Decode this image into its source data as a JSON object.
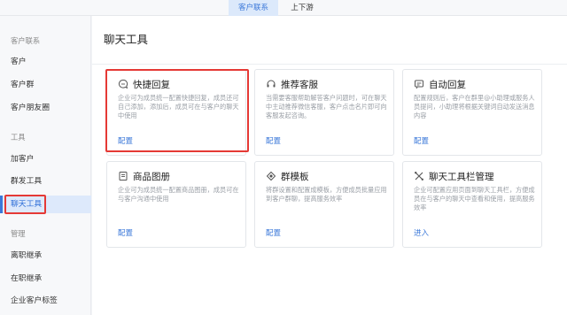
{
  "top_tabs": [
    {
      "label": "客户联系"
    },
    {
      "label": "上下游"
    }
  ],
  "sidebar": {
    "items": [
      {
        "label": "客户联系",
        "type": "heading"
      },
      {
        "label": "客户"
      },
      {
        "label": "客户群"
      },
      {
        "label": "客户朋友圈"
      },
      {
        "label": "工具",
        "type": "heading"
      },
      {
        "label": "加客户"
      },
      {
        "label": "群发工具"
      },
      {
        "label": "聊天工具",
        "active": true
      },
      {
        "label": "管理",
        "type": "heading"
      },
      {
        "label": "离职继承"
      },
      {
        "label": "在职继承"
      },
      {
        "label": "企业客户标签"
      }
    ]
  },
  "main": {
    "title": "聊天工具",
    "cards": [
      {
        "icon": "chat-bubble-icon",
        "title": "快捷回复",
        "desc": "企业可为成员统一配置快捷回复，成员还可自己添加，添加后，成员可在与客户的聊天中使用",
        "action": "配置"
      },
      {
        "icon": "headset-icon",
        "title": "推荐客服",
        "desc": "当需要客服帮助解答客户问题时，可在聊天中主动推荐微信客服，客户点击名片即可向客服发起咨询。",
        "action": "配置"
      },
      {
        "icon": "auto-reply-icon",
        "title": "自动回复",
        "desc": "配置规则后，客户在群里@小助理或服务人员提问，小助理将根据关键词自动发送消息内容",
        "action": "配置"
      },
      {
        "icon": "product-album-icon",
        "title": "商品图册",
        "desc": "企业可为成员统一配置商品图册，成员可在与客户沟通中使用",
        "action": "配置"
      },
      {
        "icon": "group-template-icon",
        "title": "群模板",
        "desc": "将群设置和配置成模板，方便成员批量应用到客户群聊，提高服务效率",
        "action": "配置"
      },
      {
        "icon": "toolbar-manage-icon",
        "title": "聊天工具栏管理",
        "desc": "企业可配置应用页面到聊天工具栏，方便成员在与客户的聊天中查看和使用，提高服务效率",
        "action": "进入"
      }
    ]
  },
  "highlight_color": "#e53935",
  "accent_color": "#3b78d9"
}
